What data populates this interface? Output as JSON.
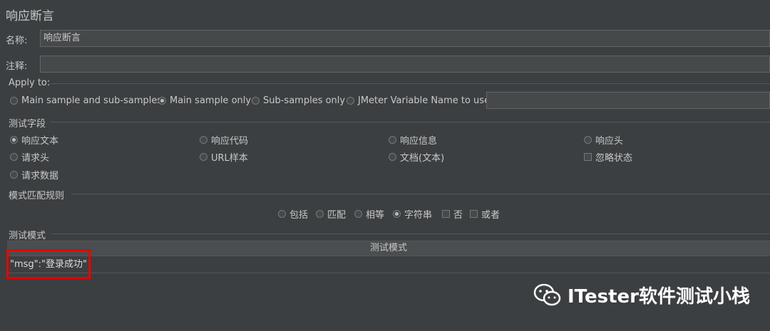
{
  "title": "响应断言",
  "name_label": "名称:",
  "name_value": "响应断言",
  "comment_label": "注释:",
  "comment_value": "",
  "apply_to": {
    "label": "Apply to:",
    "options": [
      "Main sample and sub-samples",
      "Main sample only",
      "Sub-samples only",
      "JMeter Variable Name to use"
    ],
    "selected": "Main sample only",
    "var_value": ""
  },
  "test_field": {
    "label": "测试字段",
    "options": [
      "响应文本",
      "响应代码",
      "响应信息",
      "响应头",
      "请求头",
      "URL样本",
      "文档(文本)",
      "忽略状态",
      "请求数据"
    ],
    "selected": "响应文本"
  },
  "pattern_rules": {
    "label": "模式匹配规则",
    "options": [
      "包括",
      "匹配",
      "相等",
      "字符串",
      "否",
      "或者"
    ],
    "selected": "字符串"
  },
  "test_patterns": {
    "label": "测试模式",
    "column": "测试模式",
    "rows": [
      "\"msg\":\"登录成功\""
    ]
  },
  "watermark": "ITester软件测试小栈"
}
